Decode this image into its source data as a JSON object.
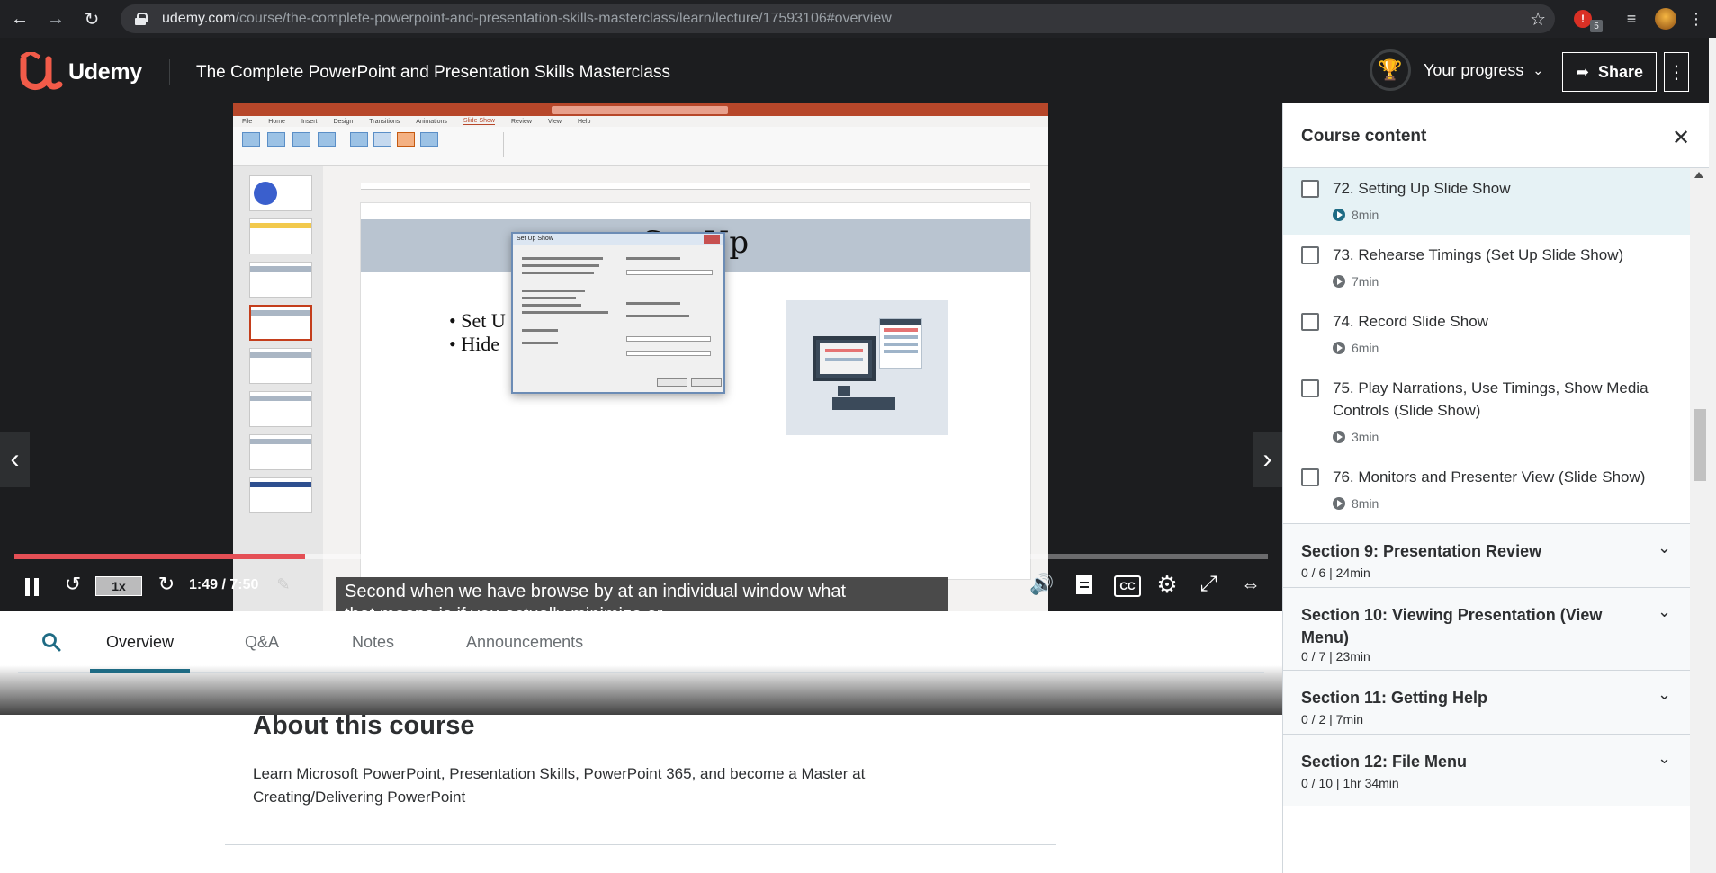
{
  "browser": {
    "url_domain": "udemy.com",
    "url_path": "/course/the-complete-powerpoint-and-presentation-skills-masterclass/learn/lecture/17593106#overview",
    "ext_badge": "5"
  },
  "header": {
    "brand": "Udemy",
    "course_title": "The Complete PowerPoint and Presentation Skills Masterclass",
    "progress_label": "Your progress",
    "share_label": "Share"
  },
  "player": {
    "slide_title": "Set Up",
    "bullets": [
      "Set U",
      "Hide"
    ],
    "dialog_title": "Set Up Show",
    "caption_lines": [
      "Second when we have browse by at an individual window what",
      "that means is if you actually minimize or"
    ],
    "speed": "1x",
    "time": "1:49 / 7:50",
    "cc_label": "CC",
    "progress": 0.232,
    "buffered": 0.77
  },
  "tabs": [
    "Overview",
    "Q&A",
    "Notes",
    "Announcements"
  ],
  "about": {
    "heading": "About this course",
    "description": "Learn Microsoft PowerPoint, Presentation Skills, PowerPoint 365, and become a Master at Creating/Delivering PowerPoint"
  },
  "sidebar": {
    "title": "Course content",
    "lectures": [
      {
        "title": "72. Setting Up Slide Show",
        "duration": "8min",
        "current": true
      },
      {
        "title": "73. Rehearse Timings (Set Up Slide Show)",
        "duration": "7min",
        "current": false
      },
      {
        "title": "74. Record Slide Show",
        "duration": "6min",
        "current": false
      },
      {
        "title": "75. Play Narrations, Use Timings, Show Media Controls (Slide Show)",
        "duration": "3min",
        "current": false
      },
      {
        "title": "76. Monitors and Presenter View (Slide Show)",
        "duration": "8min",
        "current": false
      }
    ],
    "sections": [
      {
        "title": "Section 9: Presentation Review",
        "meta": "0 / 6 | 24min"
      },
      {
        "title": "Section 10: Viewing Presentation (View Menu)",
        "meta": "0 / 7 | 23min"
      },
      {
        "title": "Section 11: Getting Help",
        "meta": "0 / 2 | 7min"
      },
      {
        "title": "Section 12: File Menu",
        "meta": "0 / 10 | 1hr 34min"
      }
    ]
  },
  "colors": {
    "brand": "#a435f0",
    "header_bg": "#1c1d1f",
    "seek_progress": "#e44f55",
    "tab_underline": "#1e6b84",
    "ppt_accent": "#b7472a"
  }
}
